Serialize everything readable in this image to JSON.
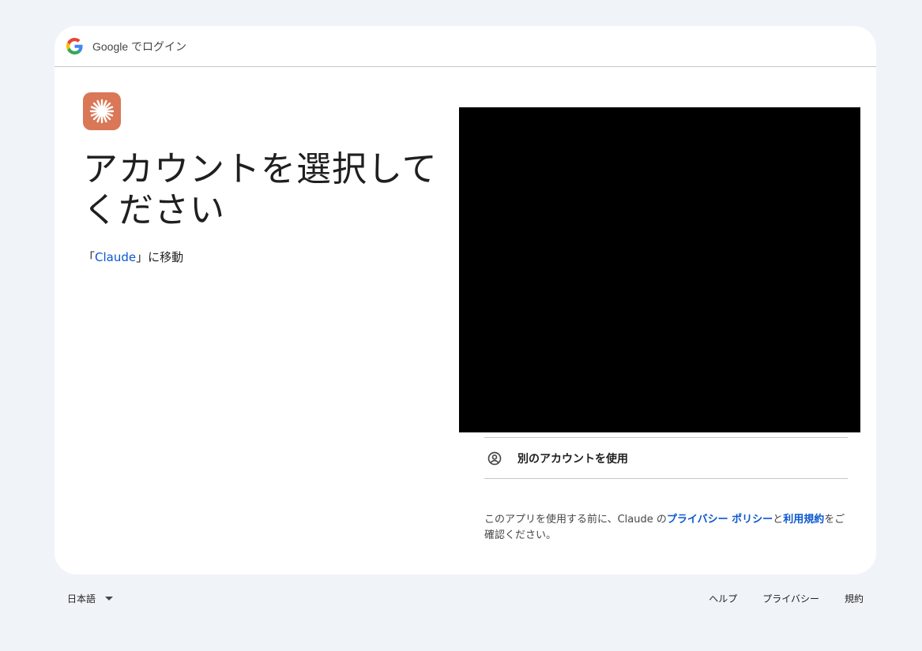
{
  "header": {
    "title": "Google でログイン",
    "logo_icon": "google-g-icon"
  },
  "app": {
    "icon": "claude-spark-icon",
    "icon_color": "#d97757"
  },
  "main": {
    "headline_line1": "アカウントを選択して",
    "headline_line2": "ください",
    "sub_prefix": "「",
    "sub_link": "Claude",
    "sub_suffix": "」に移動"
  },
  "accounts": {
    "use_other_label": "別のアカウントを使用",
    "use_other_icon": "account-circle-icon"
  },
  "disclaimer": {
    "prefix": "このアプリを使用する前に、Claude の",
    "privacy_link": "プライバシー ポリシー",
    "middle": "と",
    "terms_link": "利用規約",
    "suffix": "をご確認ください。"
  },
  "footer": {
    "language": "日本語",
    "help": "ヘルプ",
    "privacy": "プライバシー",
    "terms": "規約"
  },
  "colors": {
    "link": "#0b57d0",
    "background": "#f0f4f9"
  }
}
